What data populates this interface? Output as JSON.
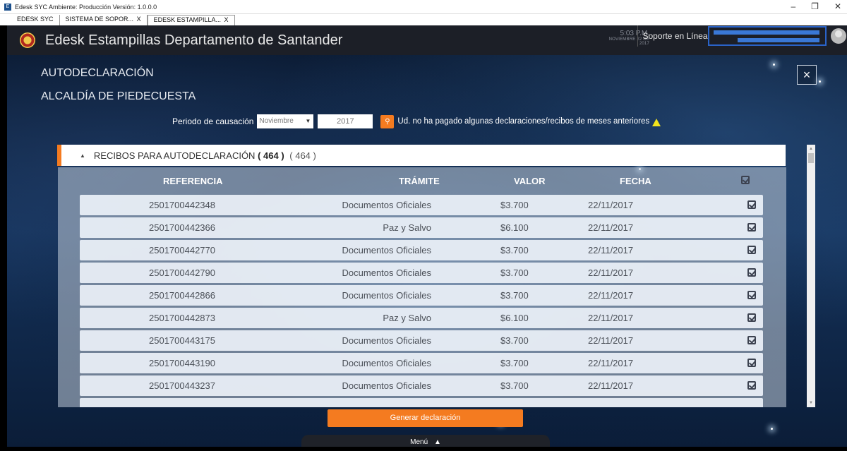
{
  "window": {
    "title": "Edesk SYC Ambiente: Producción  Versión: 1.0.0.0",
    "minimize": "–",
    "maximize": "❐",
    "close": "✕"
  },
  "tabs": [
    {
      "label": "EDESK SYC",
      "close": ""
    },
    {
      "label": "SISTEMA DE SOPOR...",
      "close": "X"
    },
    {
      "label": "EDESK ESTAMPILLA...",
      "close": "X"
    }
  ],
  "header": {
    "title": "Edesk Estampillas Departamento de Santander",
    "time": "5:03 P.M.",
    "date": "NOVIEMBRE 22 DE 2017",
    "support": "Soporte en Línea"
  },
  "page": {
    "heading": "AUTODECLARACIÓN",
    "subheading": "ALCALDÍA DE PIEDECUESTA",
    "close": "×"
  },
  "period": {
    "label": "Periodo de causación",
    "month": "Noviembre",
    "month_arrow": "▼",
    "year": "2017",
    "search_glyph": "⚲",
    "warning": "Ud. no ha pagado algunas declaraciones/recibos de meses anteriores"
  },
  "accordion": {
    "caret": "▲",
    "title": "RECIBOS PARA AUTODECLARACIÓN",
    "count": "( 464 )",
    "total": "( 464 )"
  },
  "table": {
    "headers": {
      "ref": "REFERENCIA",
      "tramite": "TRÁMITE",
      "valor": "VALOR",
      "fecha": "FECHA"
    },
    "rows": [
      {
        "ref": "2501700442348",
        "tramite": "Documentos Oficiales",
        "valor": "$3.700",
        "fecha": "22/11/2017"
      },
      {
        "ref": "2501700442366",
        "tramite": "Paz y Salvo",
        "valor": "$6.100",
        "fecha": "22/11/2017"
      },
      {
        "ref": "2501700442770",
        "tramite": "Documentos Oficiales",
        "valor": "$3.700",
        "fecha": "22/11/2017"
      },
      {
        "ref": "2501700442790",
        "tramite": "Documentos Oficiales",
        "valor": "$3.700",
        "fecha": "22/11/2017"
      },
      {
        "ref": "2501700442866",
        "tramite": "Documentos Oficiales",
        "valor": "$3.700",
        "fecha": "22/11/2017"
      },
      {
        "ref": "2501700442873",
        "tramite": "Paz y Salvo",
        "valor": "$6.100",
        "fecha": "22/11/2017"
      },
      {
        "ref": "2501700443175",
        "tramite": "Documentos Oficiales",
        "valor": "$3.700",
        "fecha": "22/11/2017"
      },
      {
        "ref": "2501700443190",
        "tramite": "Documentos Oficiales",
        "valor": "$3.700",
        "fecha": "22/11/2017"
      },
      {
        "ref": "2501700443237",
        "tramite": "Documentos Oficiales",
        "valor": "$3.700",
        "fecha": "22/11/2017"
      }
    ]
  },
  "actions": {
    "generar": "Generar declaración",
    "menu": "Menú",
    "menu_caret": "▲"
  },
  "colors": {
    "accent": "#f47b20",
    "header_bg": "#1c1f27",
    "user_accent": "#2a63c8",
    "warning": "#f2e41d"
  }
}
